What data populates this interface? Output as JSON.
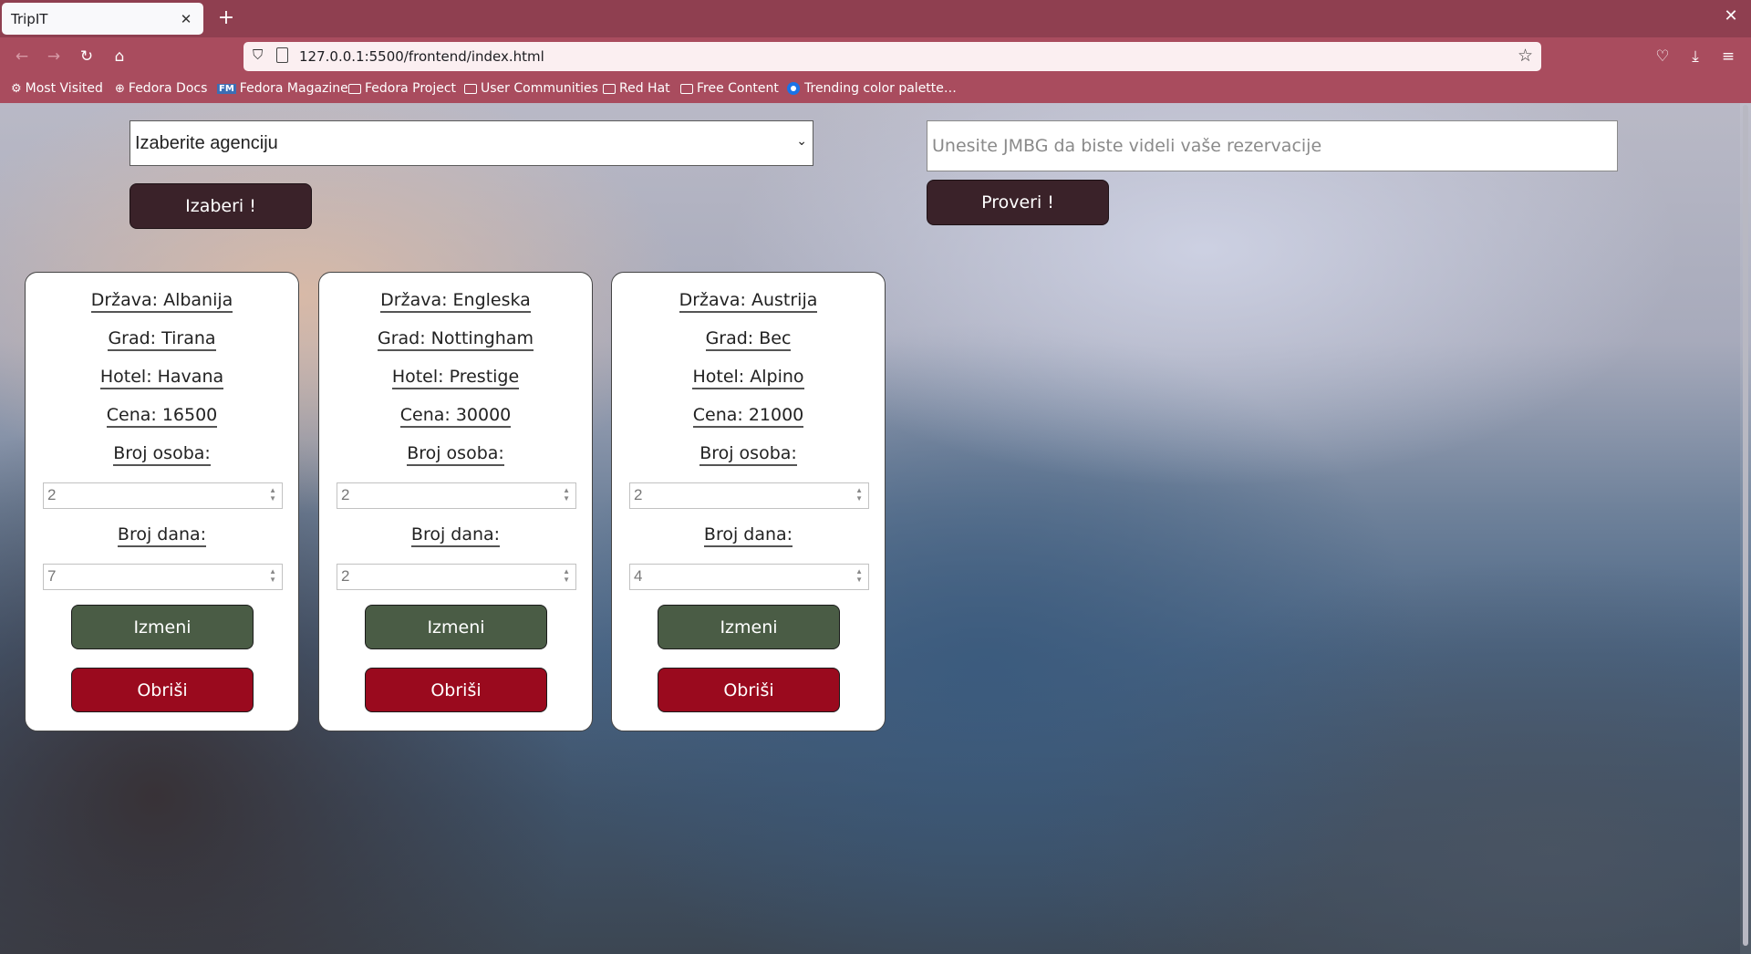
{
  "browser": {
    "tab_title": "TripIT",
    "tab_close": "✕",
    "new_tab": "+",
    "window_close": "✕",
    "url": "127.0.0.1:5500/frontend/index.html",
    "bookmarks": [
      {
        "label": "Most Visited",
        "icon": "gear-icon"
      },
      {
        "label": "Fedora Docs",
        "icon": "globe-icon"
      },
      {
        "label": "Fedora Magazine",
        "icon": "fm-icon"
      },
      {
        "label": "Fedora Project",
        "icon": "folder-icon"
      },
      {
        "label": "User Communities",
        "icon": "folder-icon"
      },
      {
        "label": "Red Hat",
        "icon": "folder-icon"
      },
      {
        "label": "Free Content",
        "icon": "folder-icon"
      },
      {
        "label": "Trending color palette…",
        "icon": "circle-icon"
      }
    ]
  },
  "page": {
    "agency_select": {
      "value": "Izaberite agenciju"
    },
    "select_button": "Izaberi !",
    "jmbg_input": {
      "placeholder": "Unesite JMBG da biste videli vaše rezervacije"
    },
    "check_button": "Proveri !",
    "cards": [
      {
        "country": "Država: Albanija",
        "city": "Grad: Tirana",
        "hotel": "Hotel: Havana",
        "price": "Cena: 16500",
        "persons_label": "Broj osoba:",
        "persons": "2",
        "days_label": "Broj dana:",
        "days": "7",
        "edit": "Izmeni",
        "delete": "Obriši"
      },
      {
        "country": "Država: Engleska",
        "city": "Grad: Nottingham",
        "hotel": "Hotel: Prestige",
        "price": "Cena: 30000",
        "persons_label": "Broj osoba:",
        "persons": "2",
        "days_label": "Broj dana:",
        "days": "2",
        "edit": "Izmeni",
        "delete": "Obriši"
      },
      {
        "country": "Država: Austrija",
        "city": "Grad: Bec",
        "hotel": "Hotel: Alpino",
        "price": "Cena: 21000",
        "persons_label": "Broj osoba:",
        "persons": "2",
        "days_label": "Broj dana:",
        "days": "4",
        "edit": "Izmeni",
        "delete": "Obriši"
      }
    ]
  },
  "colors": {
    "chrome": "#8f3f50",
    "dark_button": "#3a2229",
    "edit_button": "#4a5c45",
    "delete_button": "#9a0a1e"
  }
}
